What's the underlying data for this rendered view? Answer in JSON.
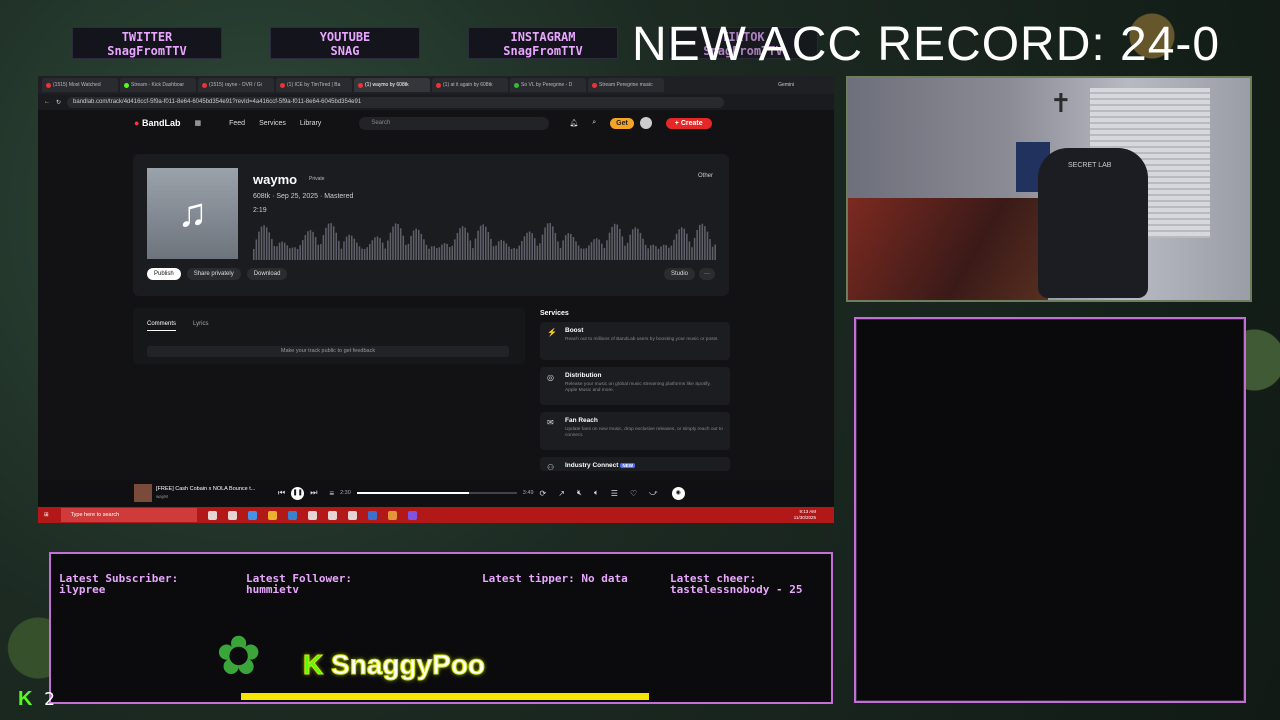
{
  "socials": [
    {
      "label": "TWITTER",
      "handle": "SnagFromTTV"
    },
    {
      "label": "YOUTUBE",
      "handle": "SNAG"
    },
    {
      "label": "INSTAGRAM",
      "handle": "SnagFromTTV"
    },
    {
      "label": "TIKTOK",
      "handle": "SnagFromTTV"
    }
  ],
  "record_text": "NEW ACC RECORD: 24-0",
  "browser": {
    "tabs": [
      "(1515) Most Watched",
      "Stream - Kick Dashboar",
      "(1515) rayne - OVR / Gi",
      "(1) ICE by TimTired | Ba",
      "(1) waymo by 608tk",
      "(1) at it again by 608tk",
      "So VL by Peregrine - D",
      "Stream Peregrine music"
    ],
    "active_tab": 4,
    "url": "bandlab.com/track/4d416ccf-5f9a-f011-8e64-6045bd354e91?revId=4a416ccf-5f9a-f011-8e64-6045bd354e91",
    "gemini": "Gemini"
  },
  "bandlab": {
    "logo": "BandLab",
    "nav": [
      "Feed",
      "Services",
      "Library"
    ],
    "search_placeholder": "Search",
    "get": "Get",
    "create": "+ Create",
    "notif_count": "1",
    "track": {
      "title": "waymo",
      "private": "Private",
      "meta": "608tk · Sep 25, 2025 · Mastered",
      "duration": "2:19",
      "other": "Other",
      "buttons": [
        "Publish",
        "Share privately",
        "Download"
      ],
      "studio": "Studio",
      "more": "···"
    },
    "comments": {
      "tabs": [
        "Comments",
        "Lyrics"
      ],
      "message": "Make your track public to get feedback"
    },
    "services": {
      "heading": "Services",
      "items": [
        {
          "icon": "⚡",
          "name": "Boost",
          "desc": "Reach out to millions of BandLab users by boosting your music or posts."
        },
        {
          "icon": "◎",
          "name": "Distribution",
          "desc": "Release your music on global music streaming platforms like Spotify, Apple Music and more."
        },
        {
          "icon": "✉",
          "name": "Fan Reach",
          "desc": "Update fans on new music, drop exclusive releases, or simply reach out to connect."
        },
        {
          "icon": "⚇",
          "name": "Industry Connect",
          "badge": "NEW",
          "desc": ""
        }
      ]
    },
    "player": {
      "title": "[FREE] Cash Cobain x NOLA Bounce t...",
      "artist": "wayM",
      "elapsed": "2:30",
      "total": "3:49",
      "progress": 0.7
    }
  },
  "taskbar": {
    "search": "Type here to search",
    "time": "9:13 AM",
    "date": "11/30/2025"
  },
  "webcam": {
    "brand": "SECRET LAB"
  },
  "alerts": {
    "subscriber_label": "Latest Subscriber:",
    "subscriber": "ilypree",
    "follower_label": "Latest Follower:",
    "follower": "hummietv",
    "tipper_label": "Latest tipper: No data",
    "cheer_label": "Latest cheer:",
    "cheer": "tastelessnobody - 25",
    "kick_name": "SnaggyPoo",
    "kick_prefix": "K",
    "goal_progress": 0.68
  },
  "kick_viewers": "2"
}
